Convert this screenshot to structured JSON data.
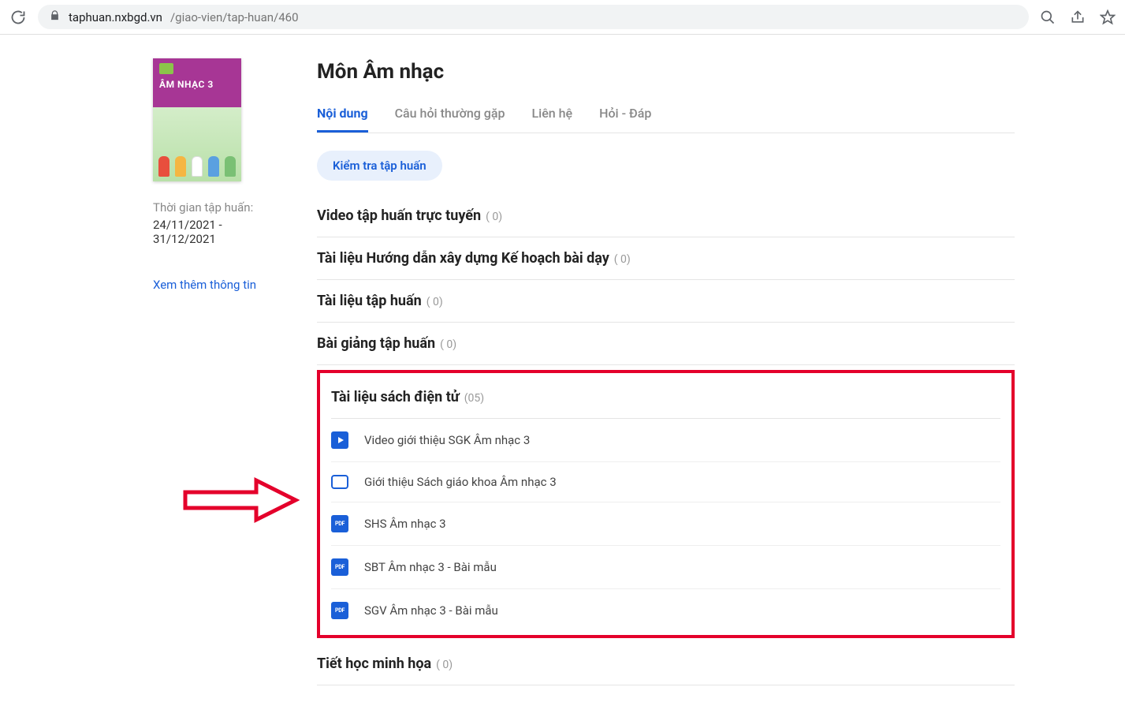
{
  "browser": {
    "url_host": "taphuan.nxbgd.vn",
    "url_path": "/giao-vien/tap-huan/460"
  },
  "sidebar": {
    "book_title": "ÂM NHẠC 3",
    "time_label": "Thời gian tập huấn:",
    "time_value": "24/11/2021 - 31/12/2021",
    "more_link": "Xem thêm thông tin"
  },
  "page_title": "Môn Âm nhạc",
  "tabs": [
    {
      "label": "Nội dung",
      "active": true
    },
    {
      "label": "Câu hỏi thường gặp",
      "active": false
    },
    {
      "label": "Liên hệ",
      "active": false
    },
    {
      "label": "Hỏi - Đáp",
      "active": false
    }
  ],
  "test_button": "Kiểm tra tập huấn",
  "sections": [
    {
      "title": "Video tập huấn trực tuyến",
      "count": "( 0)"
    },
    {
      "title": "Tài liệu Hướng dẫn xây dựng Kế hoạch bài dạy",
      "count": "( 0)"
    },
    {
      "title": "Tài liệu tập huấn",
      "count": "( 0)"
    },
    {
      "title": "Bài giảng tập huấn",
      "count": "( 0)"
    }
  ],
  "highlight_section": {
    "title": "Tài liệu sách điện tử",
    "count": "(05)",
    "items": [
      {
        "icon": "play",
        "label": "Video giới thiệu SGK Âm nhạc 3"
      },
      {
        "icon": "slide",
        "label": "Giới thiệu Sách giáo khoa Âm nhạc 3"
      },
      {
        "icon": "pdf",
        "label": "SHS Âm nhạc 3"
      },
      {
        "icon": "pdf",
        "label": "SBT Âm nhạc 3 - Bài mẫu"
      },
      {
        "icon": "pdf",
        "label": "SGV Âm nhạc 3 - Bài mẫu"
      }
    ]
  },
  "footer_section": {
    "title": "Tiết học minh họa",
    "count": "( 0)"
  },
  "pdf_badge": "PDF"
}
